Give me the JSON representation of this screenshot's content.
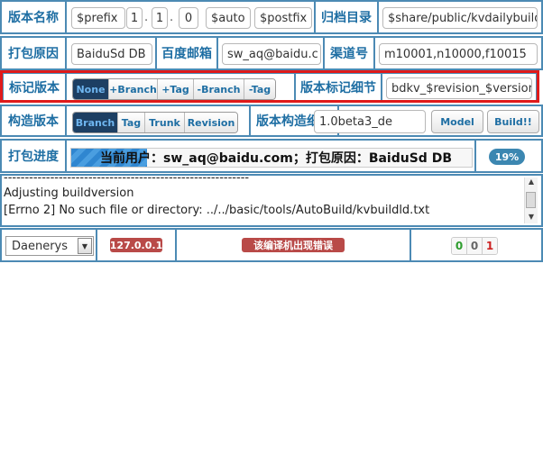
{
  "row1": {
    "label": "版本名称",
    "prefix": "$prefix",
    "v1": "1",
    "v2": "1",
    "v3": "0",
    "auto": "$auto",
    "postfix": "$postfix",
    "archive_label": "归档目录",
    "archive_value": "$share/public/kvdailybuild"
  },
  "row2": {
    "label": "打包原因",
    "reason": "BaiduSd DB",
    "email_label": "百度邮箱",
    "email": "sw_aq@baidu.c",
    "channel_label": "渠道号",
    "channel": "m10001,n10000,f10015"
  },
  "row3": {
    "label": "标记版本",
    "tag_options": [
      "None",
      "+Branch",
      "+Tag",
      "-Branch",
      "-Tag"
    ],
    "selected": "None",
    "detail_label": "版本标记细节",
    "detail": "bdkv_$revision_$version",
    "highlight_color": "#e01a1a"
  },
  "row4": {
    "label": "构造版本",
    "build_options": [
      "Branch",
      "Tag",
      "Trunk",
      "Revision"
    ],
    "selected": "Branch",
    "detail_label": "版本构造细节",
    "detail": "1.0beta3_de",
    "model_label": "Model",
    "build_label": "Build!!"
  },
  "row5": {
    "label": "打包进度",
    "progress_text": "当前用户：sw_aq@baidu.com；打包原因：BaiduSd DB",
    "percent_label": "19%",
    "percent": 0.19
  },
  "log": {
    "lines": [
      "----------------------------------------------------------",
      "Adjusting buildversion",
      "[Errno 2] No such file or directory: ../../basic/tools/AutoBuild/kvbuildld.txt"
    ]
  },
  "status": {
    "user": "Daenerys",
    "ip": "127.0.0.1",
    "error": "该编译机出现错误",
    "counts": [
      "0",
      "0",
      "1"
    ],
    "colors": {
      "green": "#2e9d2e",
      "gray": "#666666",
      "red": "#cc2222",
      "badge_red": "#b94a48"
    }
  }
}
